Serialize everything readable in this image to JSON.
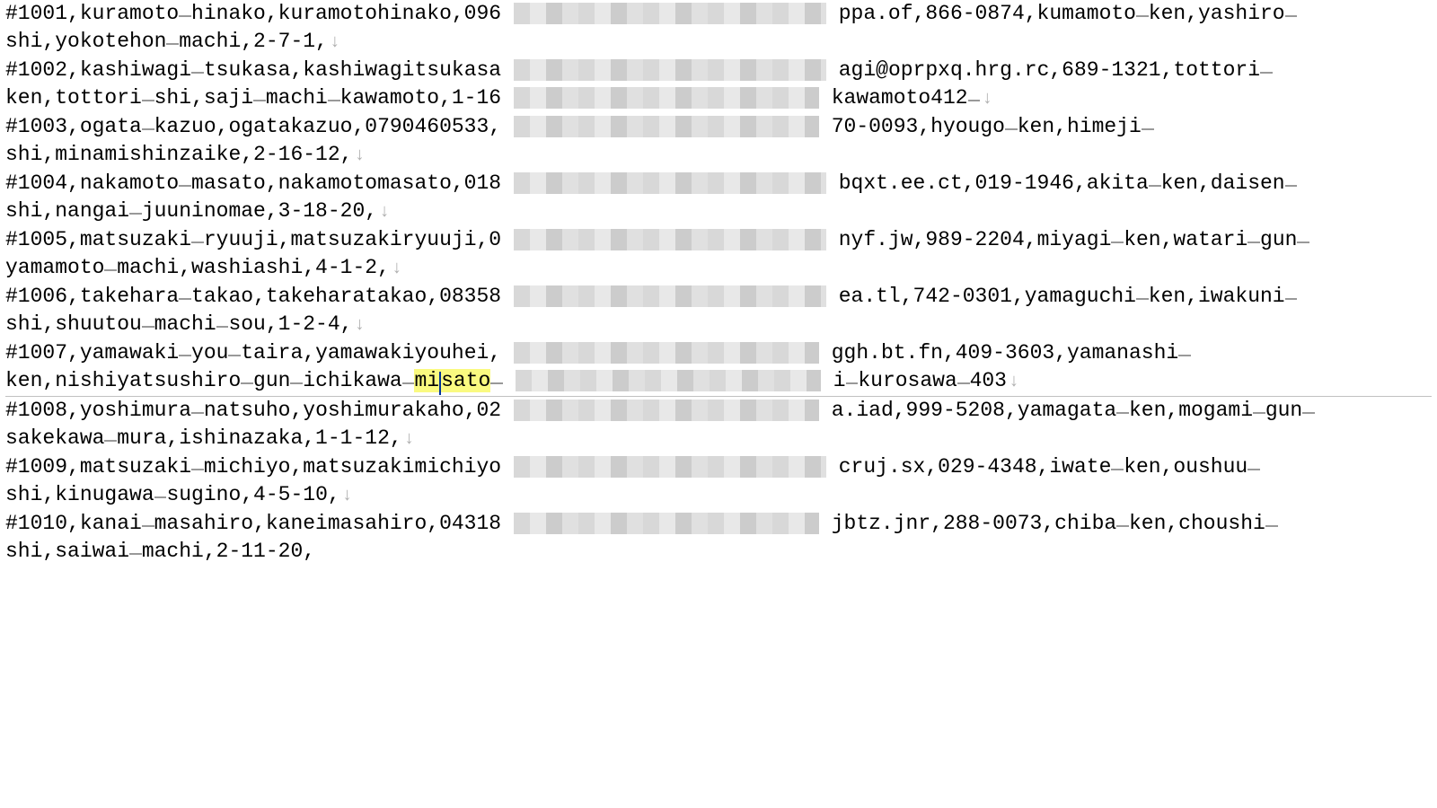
{
  "lines": [
    {
      "pre": "#1001,kuramoto",
      "u1": true,
      "mid1": "hinako,kuramotohinako,096",
      "red": "r1",
      "post": "ppa.of,866-0874,kumamoto",
      "u2": true,
      "post2": "ken,yashiro",
      "u3": true
    },
    {
      "pre": "shi,yokotehon",
      "u1": true,
      "mid1": "machi,2-7-1,",
      "arrow": true
    },
    {
      "pre": "#1002,kashiwagi",
      "u1": true,
      "mid1": "tsukasa,kashiwagitsukasa",
      "red": "r1",
      "post": "agi@oprpxq.hrg.rc,689-1321,tottori",
      "u2": true
    },
    {
      "pre": "ken,tottori",
      "u1": true,
      "mid1": "shi,saji",
      "u2": true,
      "mid2": "machi",
      "u3": true,
      "mid3": "kawamoto,1-16",
      "red": "r2",
      "post": "kawamoto",
      "u4": true,
      "post2": "412",
      "arrow": true
    },
    {
      "pre": "#1003,ogata",
      "u1": true,
      "mid1": "kazuo,ogatakazuo,0790460533,",
      "red": "r2",
      "post": "70-0093,hyougo",
      "u2": true,
      "post2": "ken,himeji",
      "u3": true
    },
    {
      "pre": "shi,minamishinzaike,2-16-12,",
      "arrow": true
    },
    {
      "pre": "#1004,nakamoto",
      "u1": true,
      "mid1": "masato,nakamotomasato,018",
      "red": "r1",
      "post": "bqxt.ee.ct,019-1946,akita",
      "u2": true,
      "post2": "ken,daisen",
      "u3": true
    },
    {
      "pre": "shi,nangai",
      "u1": true,
      "mid1": "juuninomae,3-18-20,",
      "arrow": true
    },
    {
      "pre": "#1005,matsuzaki",
      "u1": true,
      "mid1": "ryuuji,matsuzakiryuuji,0",
      "red": "r1",
      "post": "nyf.jw,989-2204,miyagi",
      "u2": true,
      "post2": "ken,watari",
      "u3": true,
      "post3": "gun",
      "u4": true
    },
    {
      "pre": "yamamoto",
      "u1": true,
      "mid1": "machi,washiashi,4-1-2,",
      "arrow": true
    },
    {
      "pre": "#1006,takehara",
      "u1": true,
      "mid1": "takao,takeharatakao,08358",
      "red": "r1",
      "post": "ea.tl,742-0301,yamaguchi",
      "u2": true,
      "post2": "ken,iwakuni",
      "u3": true
    },
    {
      "pre": "shi,shuutou",
      "u1": true,
      "mid1": "machi",
      "u2": true,
      "mid2": "sou,1-2-4,",
      "arrow": true
    },
    {
      "pre": "#1007,yamawaki",
      "u1": true,
      "mid1": "you",
      "u2": true,
      "mid2": "taira,yamawakiyouhei,",
      "red": "r2",
      "post": "ggh.bt.fn,409-3603,yamanashi",
      "u3": true
    },
    {
      "pre": "ken,nishiyatsushiro",
      "u1": true,
      "mid1": "gun",
      "u2": true,
      "mid2": "ichikawa",
      "u3": true,
      "hl_pre": "mi",
      "cursor": true,
      "hl_post": "sato",
      "u4": true,
      "red": "r2",
      "post": "i",
      "u5": true,
      "post2": "kurosawa",
      "u6": true,
      "post3": "403",
      "arrow": true,
      "rule_after": true
    },
    {
      "pre": "#1008,yoshimura",
      "u1": true,
      "mid1": "natsuho,yoshimurakaho,02",
      "red": "r2",
      "post": "a.iad,999-5208,yamagata",
      "u2": true,
      "post2": "ken,mogami",
      "u3": true,
      "post3": "gun",
      "u4": true
    },
    {
      "pre": "sakekawa",
      "u1": true,
      "mid1": "mura,ishinazaka,1-1-12,",
      "arrow": true
    },
    {
      "pre": "#1009,matsuzaki",
      "u1": true,
      "mid1": "michiyo,matsuzakimichiyo",
      "red": "r1",
      "post": "cruj.sx,029-4348,iwate",
      "u2": true,
      "post2": "ken,oushuu",
      "u3": true
    },
    {
      "pre": "shi,kinugawa",
      "u1": true,
      "mid1": "sugino,4-5-10,",
      "arrow": true
    },
    {
      "pre": "#1010,kanai",
      "u1": true,
      "mid1": "masahiro,kaneimasahiro,04318",
      "red": "r2",
      "post": "jbtz.jnr,288-0073,chiba",
      "u2": true,
      "post2": "ken,choushi",
      "u3": true
    },
    {
      "pre": "shi,saiwai",
      "u1": true,
      "mid1": "machi,2-11-20,"
    }
  ]
}
